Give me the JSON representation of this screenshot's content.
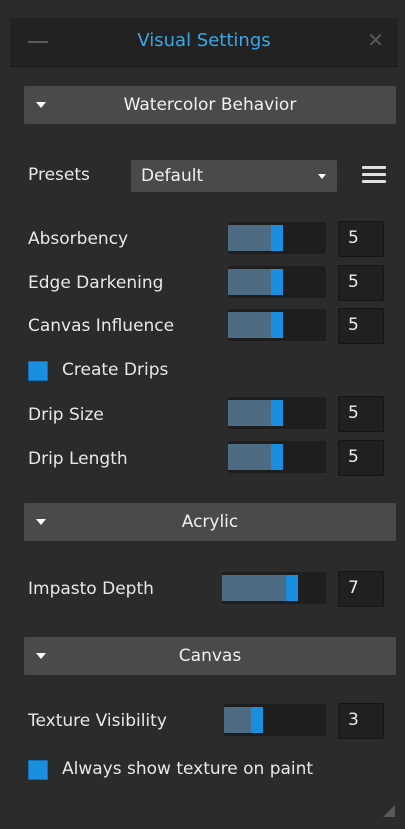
{
  "window": {
    "title": "Visual Settings"
  },
  "sections": {
    "watercolor": "Watercolor Behavior",
    "acrylic": "Acrylic",
    "canvas": "Canvas"
  },
  "presets": {
    "label": "Presets",
    "selected": "Default"
  },
  "watercolor": {
    "absorbency": {
      "label": "Absorbency",
      "value": "5",
      "fraction": 0.5
    },
    "edge_darkening": {
      "label": "Edge Darkening",
      "value": "5",
      "fraction": 0.5
    },
    "canvas_influence": {
      "label": "Canvas Influence",
      "value": "5",
      "fraction": 0.5
    },
    "create_drips": {
      "label": "Create Drips",
      "checked": true
    },
    "drip_size": {
      "label": "Drip Size",
      "value": "5",
      "fraction": 0.5
    },
    "drip_length": {
      "label": "Drip Length",
      "value": "5",
      "fraction": 0.5
    }
  },
  "acrylic": {
    "impasto_depth": {
      "label": "Impasto Depth",
      "value": "7",
      "fraction": 0.7
    }
  },
  "canvas": {
    "texture_visibility": {
      "label": "Texture Visibility",
      "value": "3",
      "fraction": 0.3
    },
    "always_show": {
      "label": "Always show texture on paint",
      "checked": true
    }
  },
  "colors": {
    "accent": "#1a8fe0",
    "title": "#3aa8e6",
    "panel": "#2b2b2b"
  }
}
